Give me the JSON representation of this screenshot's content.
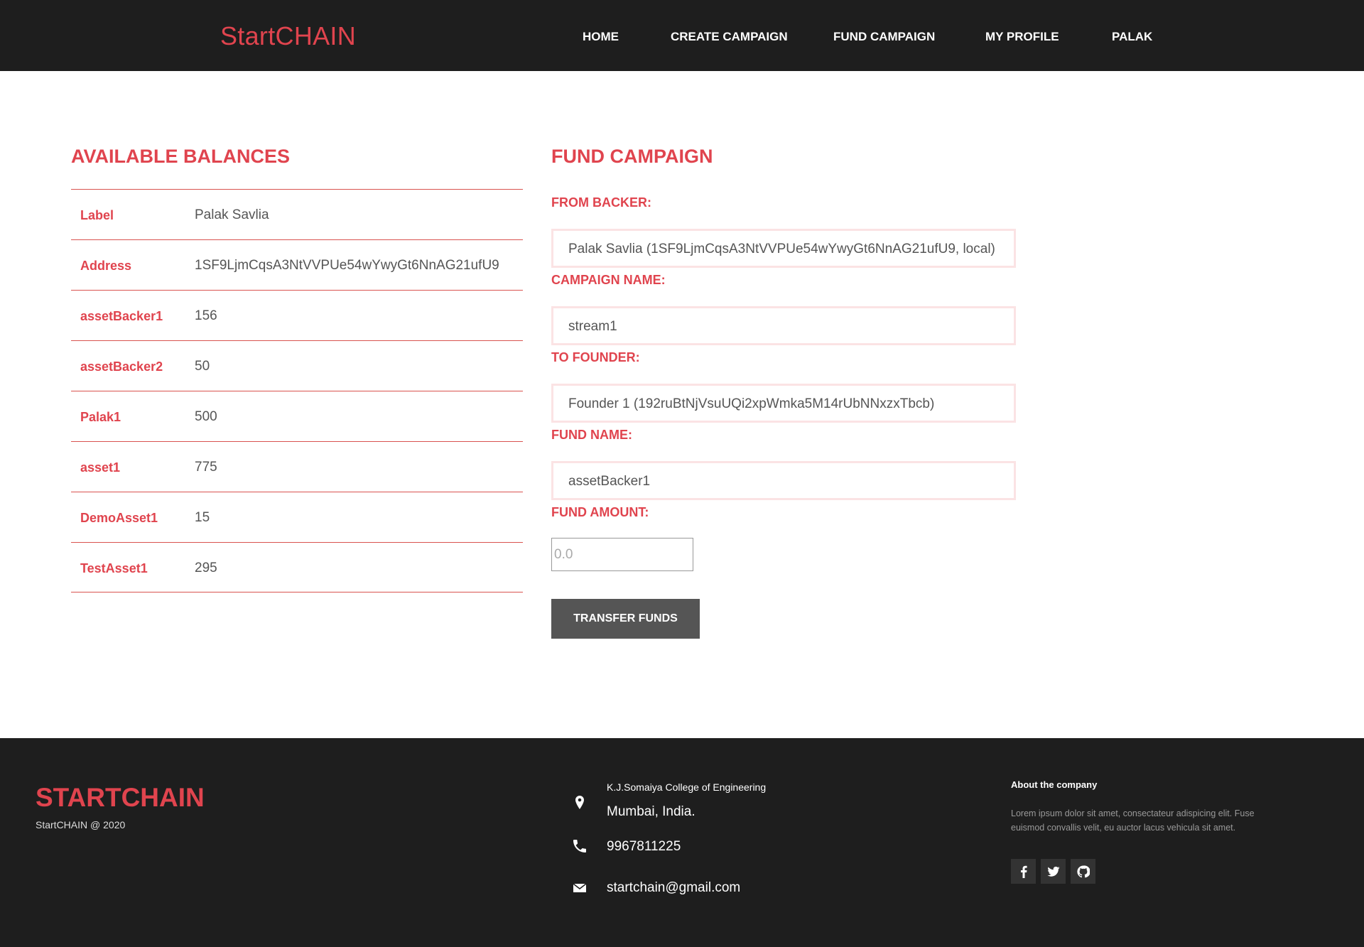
{
  "header": {
    "brand": "StartCHAIN",
    "nav": [
      "HOME",
      "CREATE CAMPAIGN",
      "FUND CAMPAIGN",
      "MY PROFILE",
      "PALAK"
    ]
  },
  "balances": {
    "title": "AVAILABLE BALANCES",
    "rows": [
      {
        "label": "Label",
        "value": "Palak Savlia"
      },
      {
        "label": "Address",
        "value": "1SF9LjmCqsA3NtVVPUe54wYwyGt6NnAG21ufU9"
      },
      {
        "label": "assetBacker1",
        "value": "156"
      },
      {
        "label": "assetBacker2",
        "value": "50"
      },
      {
        "label": "Palak1",
        "value": "500"
      },
      {
        "label": "asset1",
        "value": "775"
      },
      {
        "label": "DemoAsset1",
        "value": "15"
      },
      {
        "label": "TestAsset1",
        "value": "295"
      }
    ]
  },
  "fund_form": {
    "title": "FUND CAMPAIGN",
    "from_backer_label": "FROM BACKER:",
    "from_backer_value": "Palak Savlia (1SF9LjmCqsA3NtVVPUe54wYwyGt6NnAG21ufU9, local)",
    "campaign_name_label": "CAMPAIGN NAME:",
    "campaign_name_value": "stream1",
    "to_founder_label": "TO FOUNDER:",
    "to_founder_value": "Founder 1 (192ruBtNjVsuUQi2xpWmka5M14rUbNNxzxTbcb)",
    "fund_name_label": "FUND NAME:",
    "fund_name_value": "assetBacker1",
    "fund_amount_label": "FUND AMOUNT:",
    "fund_amount_placeholder": "0.0",
    "submit_label": "TRANSFER FUNDS"
  },
  "footer": {
    "brand": "STARTCHAIN",
    "copyright": "StartCHAIN @ 2020",
    "college": "K.J.Somaiya College of Engineering",
    "city": "Mumbai, India.",
    "phone": "9967811225",
    "email": "startchain@gmail.com",
    "about_title": "About the company",
    "about_text": "Lorem ipsum dolor sit amet, consectateur adispicing elit. Fuse euismod convallis velit, eu auctor lacus vehicula sit amet.",
    "social": [
      "facebook-icon",
      "twitter-icon",
      "github-icon"
    ]
  },
  "colors": {
    "accent": "#e0444e",
    "dark": "#1e1e1e",
    "button": "#555555"
  }
}
